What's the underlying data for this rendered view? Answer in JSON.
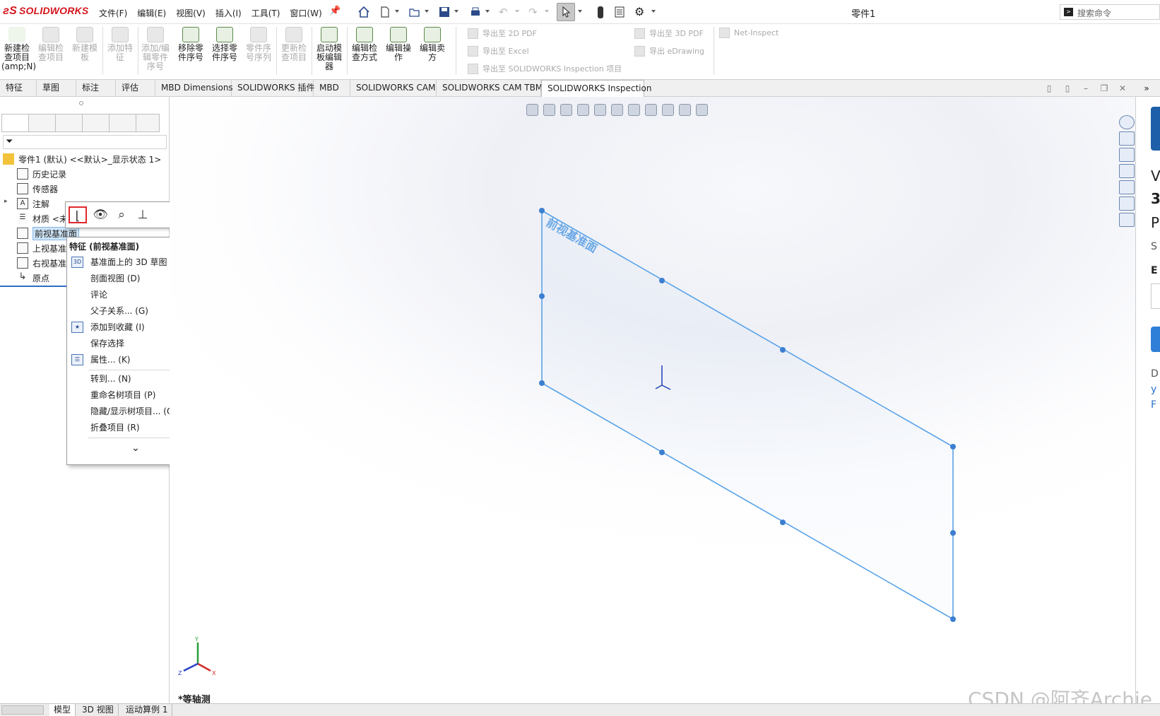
{
  "app": {
    "logo_text": "SOLIDWORKS",
    "document_title": "零件1"
  },
  "menus": [
    "文件(F)",
    "编辑(E)",
    "视图(V)",
    "插入(I)",
    "工具(T)",
    "窗口(W)"
  ],
  "search": {
    "placeholder": "搜索命令"
  },
  "ribbon": {
    "buttons": [
      {
        "label": "新建检\n查项目\n(amp;N)",
        "enabled": true
      },
      {
        "label": "编辑检\n查项目",
        "enabled": false
      },
      {
        "label": "新建模\n板",
        "enabled": false
      },
      {
        "label": "添加特\n征",
        "enabled": false
      },
      {
        "label": "添加/编\n辑零件\n序号",
        "enabled": false
      },
      {
        "label": "移除零\n件序号",
        "enabled": true
      },
      {
        "label": "选择零\n件序号",
        "enabled": true
      },
      {
        "label": "零件序\n号序列",
        "enabled": false
      },
      {
        "label": "更新检\n查项目",
        "enabled": false
      },
      {
        "label": "启动模\n板编辑\n器",
        "enabled": true
      },
      {
        "label": "编辑检\n查方式",
        "enabled": true
      },
      {
        "label": "编辑操\n作",
        "enabled": true
      },
      {
        "label": "编辑卖\n方",
        "enabled": true
      }
    ],
    "exports": {
      "pdf2d": "导出至 2D PDF",
      "excel": "导出至 Excel",
      "sw_inspection": "导出至 SOLIDWORKS Inspection 项目",
      "pdf3d": "导出至 3D PDF",
      "edrawing": "导出 eDrawing",
      "net_inspect": "Net-Inspect"
    }
  },
  "tabs": [
    "特征",
    "草图",
    "标注",
    "评估",
    "MBD Dimensions",
    "SOLIDWORKS 插件",
    "MBD",
    "SOLIDWORKS CAM",
    "SOLIDWORKS CAM TBM",
    "SOLIDWORKS Inspection"
  ],
  "active_tab": "SOLIDWORKS Inspection",
  "feature_tree": {
    "root": "零件1 (默认) <<默认>_显示状态 1>",
    "items": [
      "历史记录",
      "传感器",
      "注解",
      "材质 <未",
      "前视基准面",
      "上视基准",
      "右视基准",
      "原点"
    ],
    "selected": "前视基准面"
  },
  "context_menu": {
    "header": "特征 (前视基准面)",
    "items": [
      {
        "label": "基准面上的 3D 草图 (C)",
        "icon": "3d-sketch-icon"
      },
      {
        "label": "剖面视图 (D)"
      },
      {
        "label": "评论",
        "submenu": true
      },
      {
        "label": "父子关系... (G)"
      },
      {
        "label": "添加到收藏 (I)",
        "icon": "favorite-icon"
      },
      {
        "label": "保存选择",
        "submenu": true
      },
      {
        "label": "属性... (K)",
        "icon": "properties-icon"
      },
      {
        "label": "转到... (N)"
      },
      {
        "label": "重命名树项目 (P)"
      },
      {
        "label": "隐藏/显示树项目... (Q)"
      },
      {
        "label": "折叠项目 (R)"
      }
    ],
    "expand_glyph": "⌄"
  },
  "viewport": {
    "plane_label": "前视基准面",
    "view_name": "*等轴测",
    "triad": {
      "x": "X",
      "y": "Y",
      "z": "Z"
    }
  },
  "right_pane_chars": [
    "V",
    "3",
    "P",
    "S",
    "E",
    "D",
    "y",
    "F"
  ],
  "bottom_tabs": [
    "模型",
    "3D 视图",
    "运动算例 1"
  ],
  "watermark": "CSDN @阿齐Archie",
  "colors": {
    "accent": "#5aa3e8",
    "brand": "#d4141c",
    "highlight": "#e0282c"
  }
}
